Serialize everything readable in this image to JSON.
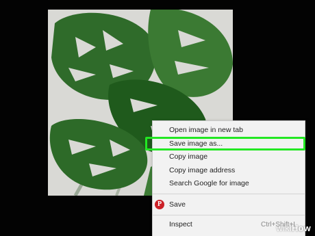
{
  "context_menu": {
    "items": [
      {
        "label": "Open image in new tab"
      },
      {
        "label": "Save image as..."
      },
      {
        "label": "Copy image"
      },
      {
        "label": "Copy image address"
      },
      {
        "label": "Search Google for image"
      }
    ],
    "pinterest_save": {
      "label": "Save",
      "icon": "pinterest-icon",
      "icon_glyph": "P"
    },
    "inspect": {
      "label": "Inspect",
      "shortcut": "Ctrl+Shift+I"
    }
  },
  "highlight": {
    "target": "Save image as...",
    "color": "#23e823"
  },
  "image": {
    "subject_icon": "monstera-leaf-photo"
  },
  "watermark": {
    "brand_prefix": "wiki",
    "brand_suffix": "How"
  },
  "colors": {
    "background": "#030303",
    "menu_background": "#f2f2f2",
    "highlight": "#23e823",
    "pinterest": "#cb2027"
  }
}
